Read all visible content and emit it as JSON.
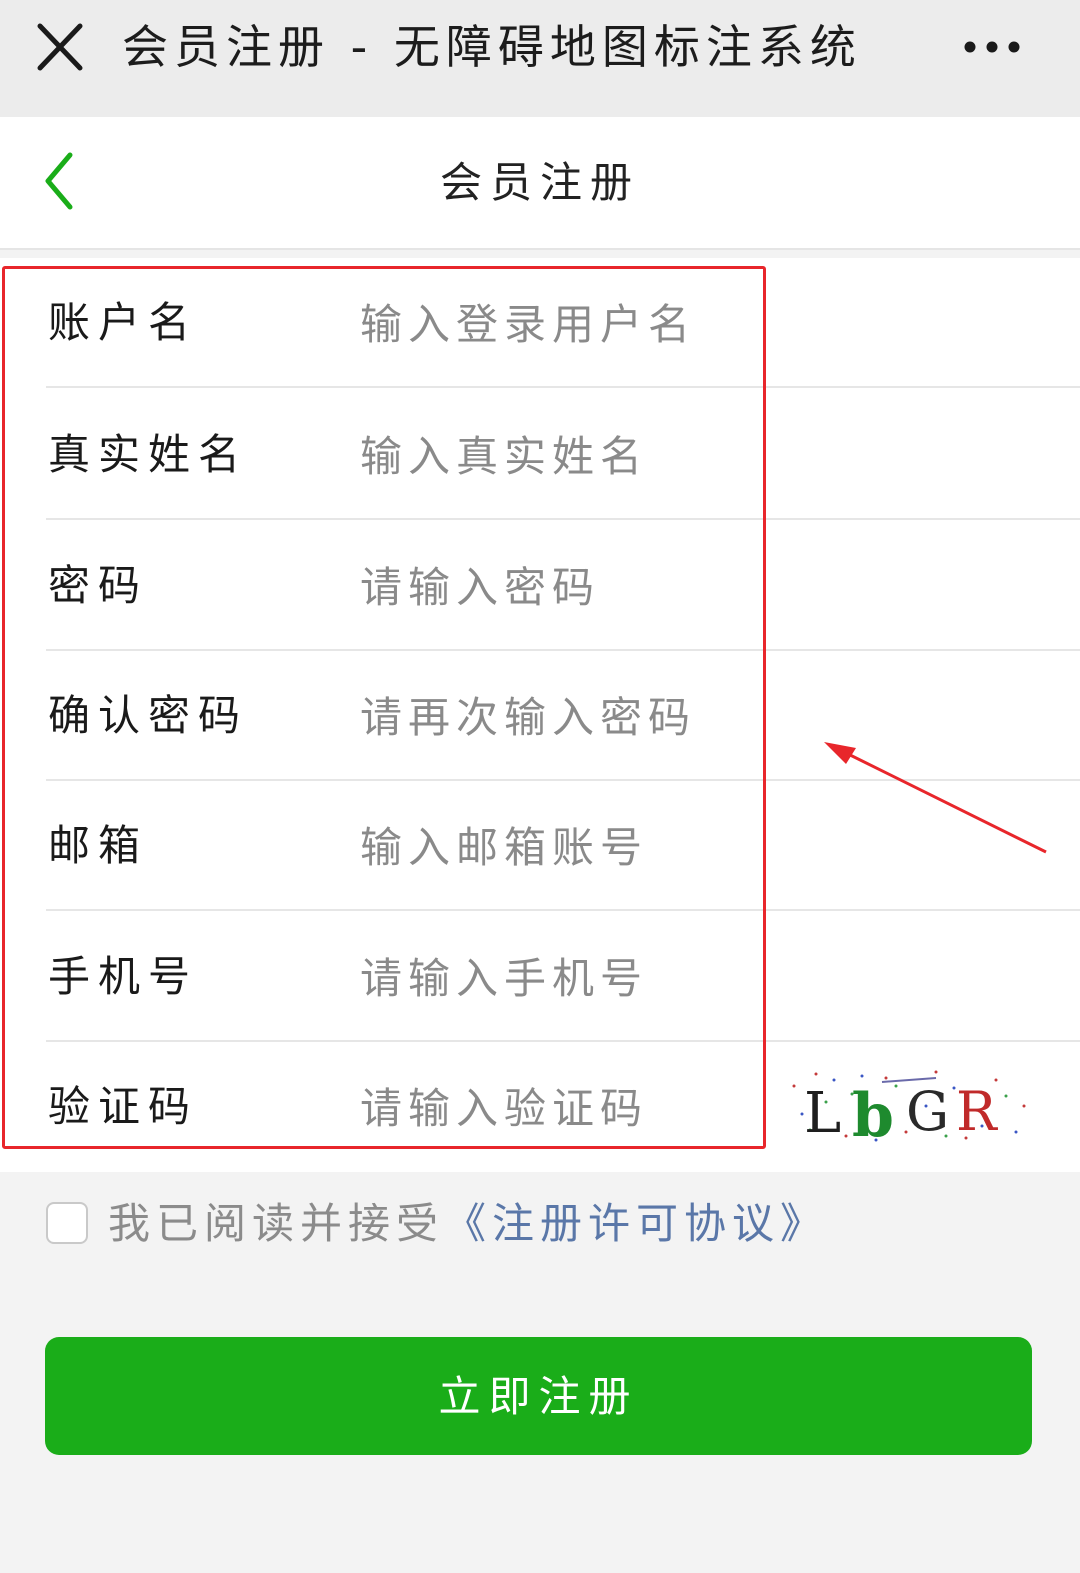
{
  "window": {
    "title": "会员注册 - 无障碍地图标注系统"
  },
  "header": {
    "title": "会员注册"
  },
  "form": {
    "fields": [
      {
        "label": "账户名",
        "placeholder": "输入登录用户名"
      },
      {
        "label": "真实姓名",
        "placeholder": "输入真实姓名"
      },
      {
        "label": "密码",
        "placeholder": "请输入密码"
      },
      {
        "label": "确认密码",
        "placeholder": "请再次输入密码"
      },
      {
        "label": "邮箱",
        "placeholder": "输入邮箱账号"
      },
      {
        "label": "手机号",
        "placeholder": "请输入手机号"
      },
      {
        "label": "验证码",
        "placeholder": "请输入验证码"
      }
    ],
    "captcha_text": "LbGR"
  },
  "agreement": {
    "text": "我已阅读并接受",
    "link": "《注册许可协议》",
    "checked": false
  },
  "submit": {
    "label": "立即注册"
  },
  "colors": {
    "accent_green": "#1aad19",
    "annotation_red": "#e8262b",
    "link_blue": "#5a77a8"
  },
  "icons": {
    "close": "close-icon",
    "more": "more-dots-icon",
    "back": "chevron-left-icon"
  }
}
